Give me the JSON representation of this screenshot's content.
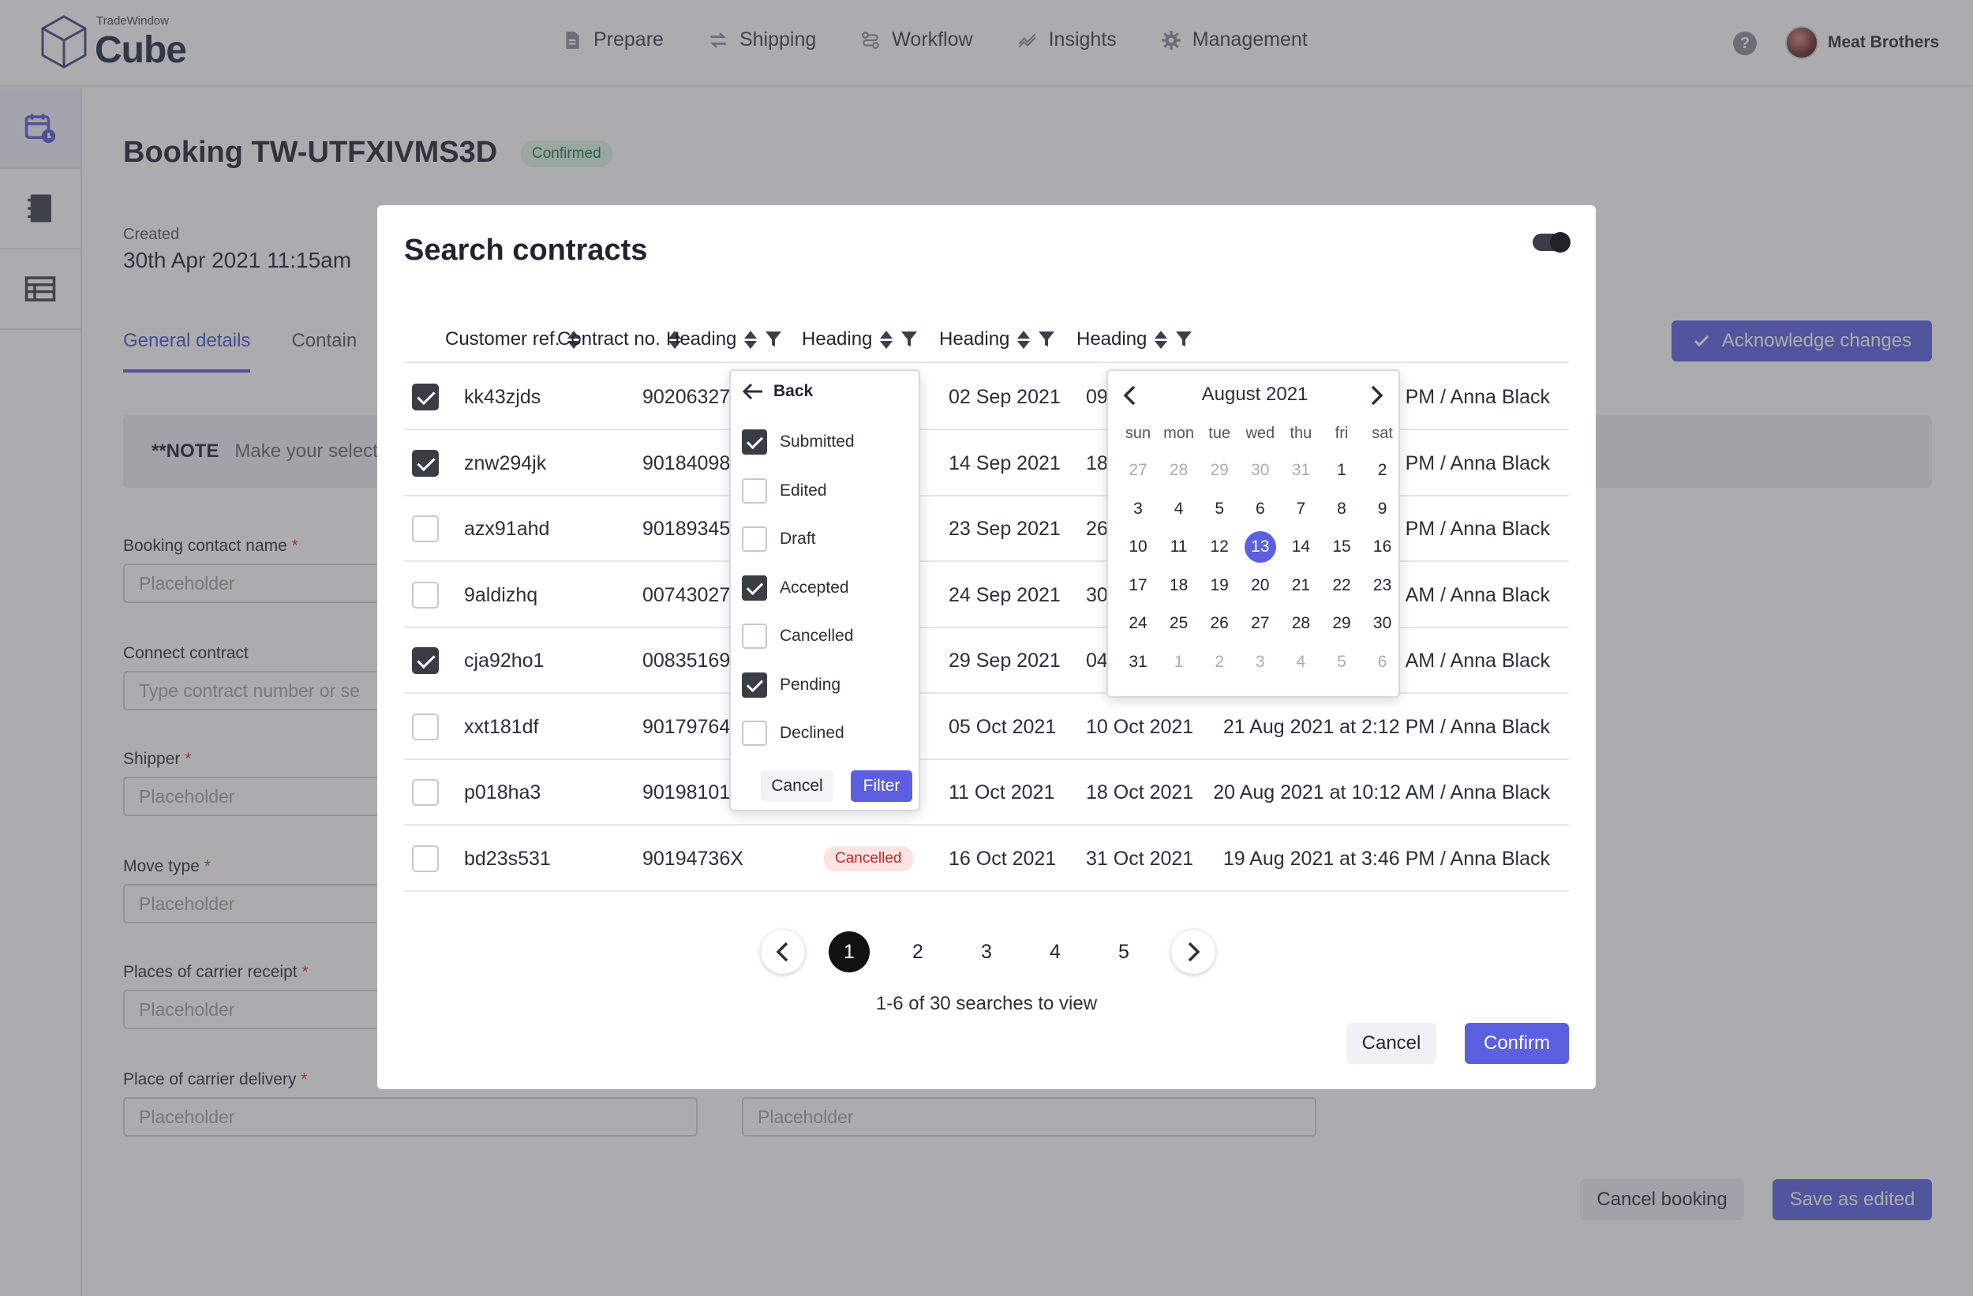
{
  "app": {
    "logo_small": "TradeWindow",
    "logo_name": "Cube",
    "nav": [
      {
        "label": "Prepare",
        "icon": "document-icon"
      },
      {
        "label": "Shipping",
        "icon": "arrows-swap-icon"
      },
      {
        "label": "Workflow",
        "icon": "workflow-icon"
      },
      {
        "label": "Insights",
        "icon": "trend-icon"
      },
      {
        "label": "Management",
        "icon": "gear-icon"
      }
    ],
    "help": "?",
    "account_name": "Meat Brothers"
  },
  "booking": {
    "title": "Booking TW-UTFXIVMS3D",
    "status": "Confirmed",
    "created_label": "Created",
    "created_value": "30th Apr 2021 11:15am",
    "tabs": [
      "General details",
      "Contain"
    ],
    "acknowledge_label": "Acknowledge changes",
    "note_label": "**NOTE",
    "note_text": "Make your select",
    "fields": {
      "contact_name": {
        "label": "Booking contact name",
        "placeholder": "Placeholder"
      },
      "connect_contract": {
        "label": "Connect contract",
        "placeholder": "Type contract number or se"
      },
      "shipper": {
        "label": "Shipper",
        "placeholder": "Placeholder"
      },
      "move_type": {
        "label": "Move type",
        "placeholder": "Placeholder"
      },
      "carrier_receipt": {
        "label": "Places of carrier receipt",
        "placeholder": "Placeholder"
      },
      "carrier_delivery": {
        "label": "Place of carrier delivery",
        "placeholder": "Placeholder",
        "placeholder2": "Placeholder"
      }
    },
    "required_mark": "*",
    "cancel_booking": "Cancel booking",
    "save_edited": "Save as edited"
  },
  "modal": {
    "title": "Search contracts",
    "columns": [
      "Customer ref.",
      "Contract no.",
      "Heading",
      "Heading",
      "Heading",
      "Heading"
    ],
    "rows": [
      {
        "checked": true,
        "ref": "kk43zjds",
        "contract": "90206327",
        "status": "",
        "d1": "02 Sep 2021",
        "d2": "09",
        "updated": "PM / Anna Black"
      },
      {
        "checked": true,
        "ref": "znw294jk",
        "contract": "90184098",
        "status": "",
        "d1": "14 Sep 2021",
        "d2": "18",
        "updated": "PM / Anna Black"
      },
      {
        "checked": false,
        "ref": "azx91ahd",
        "contract": "90189345",
        "status": "",
        "d1": "23 Sep 2021",
        "d2": "26",
        "updated": "6 PM / Anna Black"
      },
      {
        "checked": false,
        "ref": "9aldizhq",
        "contract": "00743027",
        "status": "",
        "d1": "24 Sep 2021",
        "d2": "30",
        "updated": "7 AM / Anna Black"
      },
      {
        "checked": true,
        "ref": "cja92ho1",
        "contract": "00835169",
        "status": "",
        "d1": "29 Sep 2021",
        "d2": "04",
        "updated": "0 AM / Anna Black"
      },
      {
        "checked": false,
        "ref": "xxt181df",
        "contract": "90179764",
        "status": "",
        "d1": "05 Oct 2021",
        "d2": "10 Oct 2021",
        "updated": "21 Aug 2021 at 2:12 PM / Anna Black"
      },
      {
        "checked": false,
        "ref": "p018ha3",
        "contract": "90198101",
        "status": "",
        "d1": "11 Oct 2021",
        "d2": "18 Oct 2021",
        "updated": "20 Aug 2021 at 10:12 AM / Anna Black"
      },
      {
        "checked": false,
        "ref": "bd23s531",
        "contract": "90194736X",
        "status": "Cancelled",
        "d1": "16 Oct 2021",
        "d2": "31 Oct 2021",
        "updated": "19 Aug 2021 at 3:46 PM / Anna Black"
      }
    ],
    "filter": {
      "back_label": "Back",
      "options": [
        {
          "label": "Submitted",
          "checked": true
        },
        {
          "label": "Edited",
          "checked": false
        },
        {
          "label": "Draft",
          "checked": false
        },
        {
          "label": "Accepted",
          "checked": true
        },
        {
          "label": "Cancelled",
          "checked": false
        },
        {
          "label": "Pending",
          "checked": true
        },
        {
          "label": "Declined",
          "checked": false
        }
      ],
      "cancel_label": "Cancel",
      "filter_label": "Filter"
    },
    "calendar": {
      "month_label": "August 2021",
      "weekdays": [
        "sun",
        "mon",
        "tue",
        "wed",
        "thu",
        "fri",
        "sat"
      ],
      "weeks": [
        [
          "27",
          "28",
          "29",
          "30",
          "31",
          "1",
          "2"
        ],
        [
          "3",
          "4",
          "5",
          "6",
          "7",
          "8",
          "9"
        ],
        [
          "10",
          "11",
          "12",
          "13",
          "14",
          "15",
          "16"
        ],
        [
          "17",
          "18",
          "19",
          "20",
          "21",
          "22",
          "23"
        ],
        [
          "24",
          "25",
          "26",
          "27",
          "28",
          "29",
          "30"
        ],
        [
          "31",
          "1",
          "2",
          "3",
          "4",
          "5",
          "6"
        ]
      ],
      "selected_day": "13"
    },
    "pagination": {
      "pages": [
        "1",
        "2",
        "3",
        "4",
        "5"
      ],
      "current": "1",
      "summary": "1-6 of 30 searches to view"
    },
    "cancel_label": "Cancel",
    "confirm_label": "Confirm"
  }
}
